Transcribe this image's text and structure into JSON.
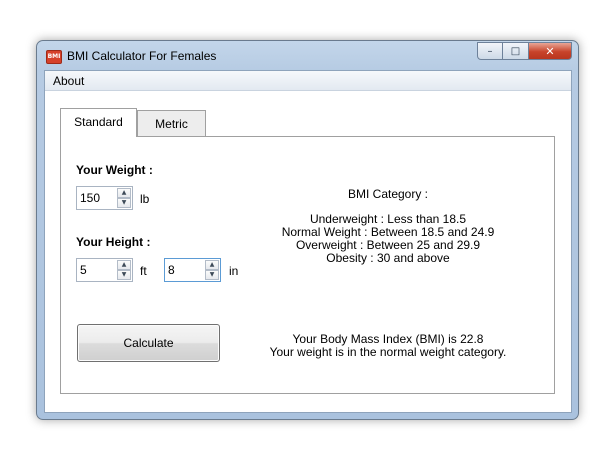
{
  "window": {
    "title": "BMI Calculator For Females",
    "icon_text": "BMI",
    "buttons": {
      "minimize": "–",
      "maximize": "□",
      "close": "✕"
    }
  },
  "menu": {
    "items": [
      {
        "label": "About"
      }
    ]
  },
  "tabs": [
    {
      "label": "Standard",
      "active": true
    },
    {
      "label": "Metric",
      "active": false
    }
  ],
  "form": {
    "weight_label": "Your Weight :",
    "weight_value": "150",
    "weight_unit": "lb",
    "height_label": "Your Height :",
    "height_ft_value": "5",
    "height_ft_unit": "ft",
    "height_in_value": "8",
    "height_in_unit": "in",
    "calculate_label": "Calculate"
  },
  "category": {
    "heading": "BMI Category :",
    "lines": [
      "Underweight : Less than 18.5",
      "Normal Weight : Between 18.5 and 24.9",
      "Overweight : Between 25 and 29.9",
      "Obesity : 30 and above"
    ]
  },
  "result": {
    "line1": "Your Body Mass Index (BMI) is 22.8",
    "line2": "Your weight is in the normal weight category."
  },
  "icons": {
    "up": "▲",
    "down": "▼"
  },
  "colors": {
    "close_button": "#c8432a",
    "app_icon": "#d6412a",
    "focus_border": "#5b9bd5"
  }
}
